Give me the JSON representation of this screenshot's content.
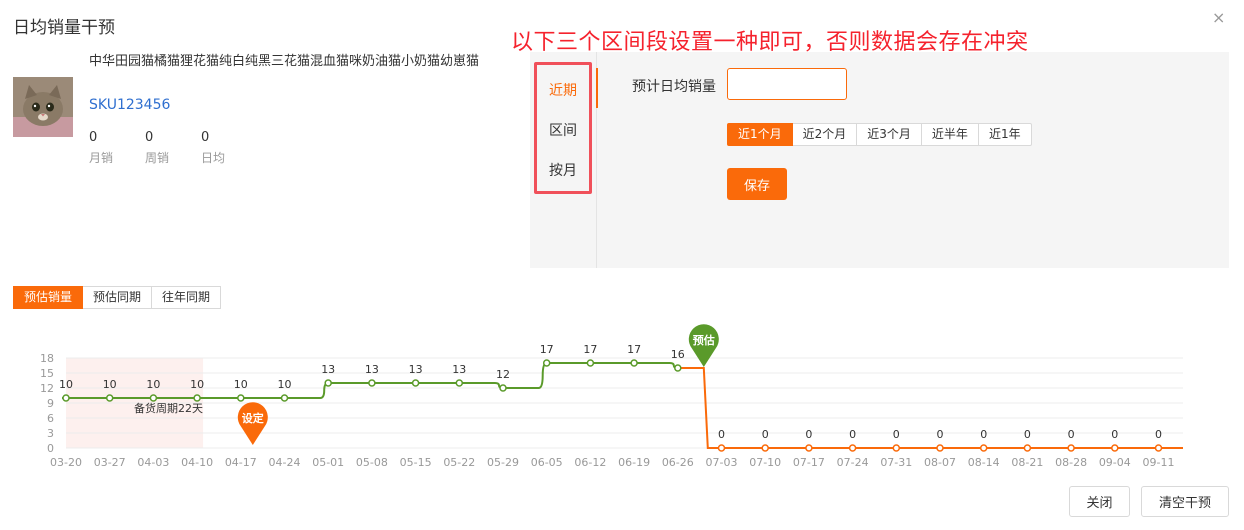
{
  "header": {
    "title": "日均销量干预",
    "close_icon": "×"
  },
  "warning_text": "以下三个区间段设置一种即可，否则数据会存在冲突",
  "product": {
    "name": "中华田园猫橘猫狸花猫纯白纯黑三花猫混血猫咪奶油猫小奶猫幼崽猫",
    "sku": "SKU123456",
    "stats": [
      {
        "value": "0",
        "label": "月销"
      },
      {
        "value": "0",
        "label": "周销"
      },
      {
        "value": "0",
        "label": "日均"
      }
    ]
  },
  "panel": {
    "tabs": [
      "近期",
      "区间",
      "按月"
    ],
    "active_tab": 0,
    "input_label": "预计日均销量",
    "input_value": "",
    "ranges": [
      "近1个月",
      "近2个月",
      "近3个月",
      "近半年",
      "近1年"
    ],
    "active_range": 0,
    "save_label": "保存"
  },
  "chart_tabs": [
    "预估销量",
    "预估同期",
    "往年同期"
  ],
  "active_chart_tab": 0,
  "chart_data": {
    "type": "line",
    "categories": [
      "03-20",
      "03-27",
      "04-03",
      "04-10",
      "04-17",
      "04-24",
      "05-01",
      "05-08",
      "05-15",
      "05-22",
      "05-29",
      "06-05",
      "06-12",
      "06-19",
      "06-26",
      "07-03",
      "07-10",
      "07-17",
      "07-24",
      "07-31",
      "08-07",
      "08-14",
      "08-21",
      "08-28",
      "09-04",
      "09-11"
    ],
    "values": [
      10,
      10,
      10,
      10,
      10,
      10,
      13,
      13,
      13,
      13,
      12,
      17,
      17,
      17,
      16,
      0,
      0,
      0,
      0,
      0,
      0,
      0,
      0,
      0,
      0,
      0
    ],
    "forecast_start_index": 15,
    "ylim": [
      0,
      18
    ],
    "yticks": [
      0,
      3,
      6,
      9,
      12,
      15,
      18
    ],
    "stocking_period_label": "备货周期22天",
    "stocking_period_range": [
      "03-20",
      "04-10"
    ],
    "set_marker_label": "设定",
    "set_marker_category": "04-17",
    "forecast_marker_label": "预估",
    "colors": {
      "history": "#5a9a2a",
      "forecast": "#fa6a0a",
      "shade": "#fdf0ee",
      "grid": "#ececec"
    }
  },
  "footer": {
    "close_label": "关闭",
    "clear_label": "清空干预"
  }
}
